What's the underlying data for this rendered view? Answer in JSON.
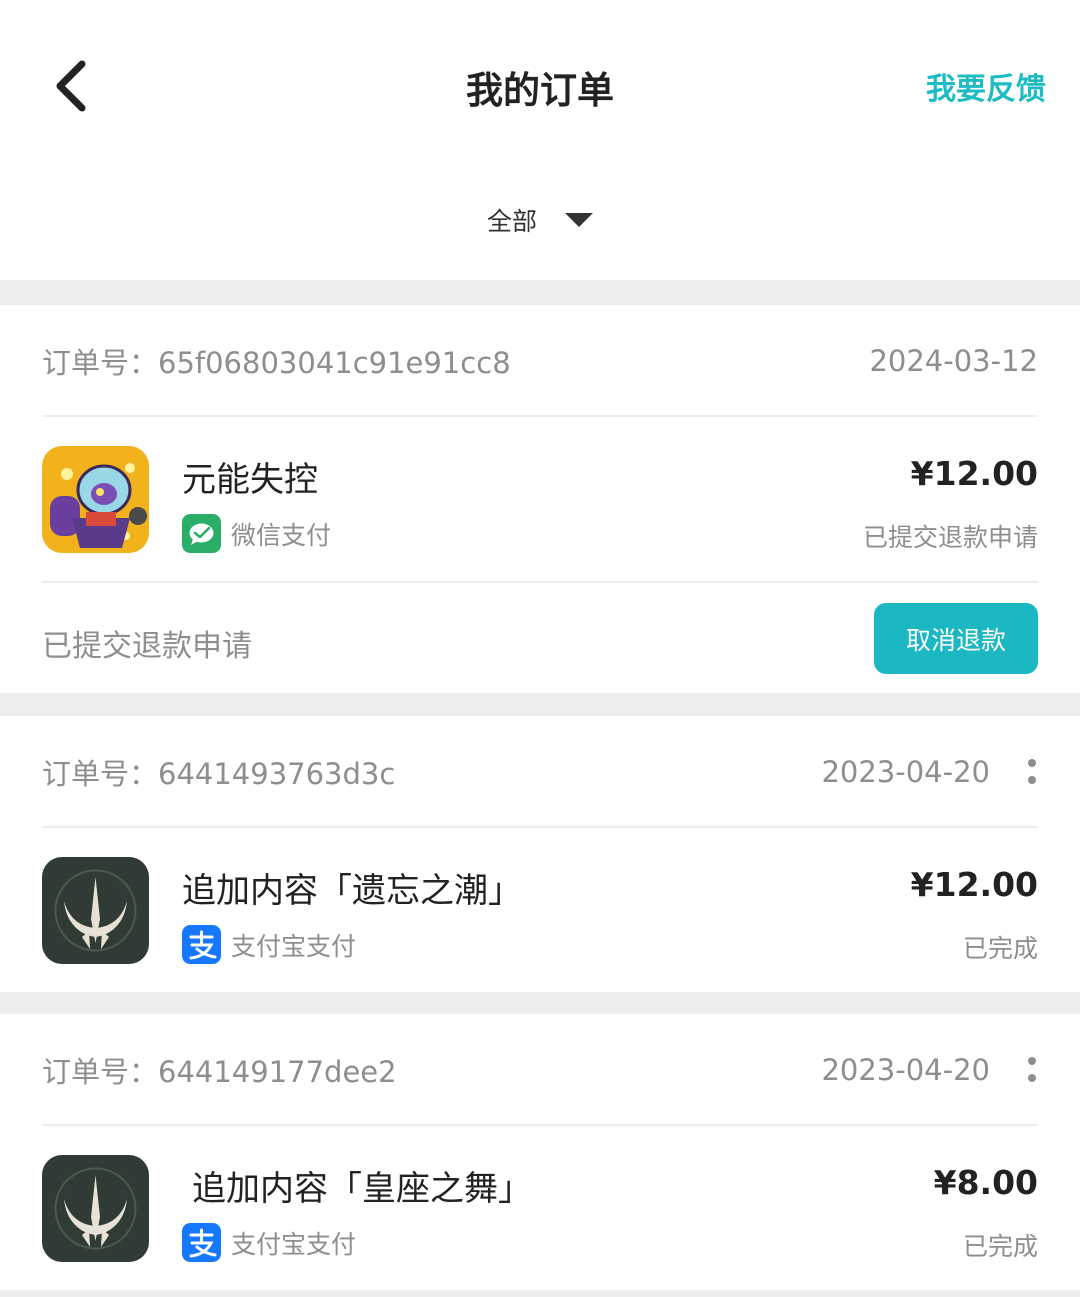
{
  "header": {
    "title": "我的订单",
    "feedback": "我要反馈",
    "back_icon": "chevron-left-icon"
  },
  "filter": {
    "label": "全部",
    "icon": "caret-down-icon"
  },
  "orders": [
    {
      "order_label": "订单号：65f06803041c91e91cc8",
      "date": "2024-03-12",
      "title": "元能失控",
      "payment": "微信支付",
      "payment_icon": "wechat-pay-icon",
      "price": "¥12.00",
      "status": "已提交退款申请",
      "footer_status": "已提交退款申请",
      "action": "取消退款"
    },
    {
      "order_label": "订单号：6441493763d3c",
      "date": "2023-04-20",
      "title": "追加内容「遗忘之潮」",
      "payment": "支付宝支付",
      "payment_icon": "alipay-icon",
      "price": "¥12.00",
      "status": "已完成"
    },
    {
      "order_label": "订单号：644149177dee2",
      "date": "2023-04-20",
      "title": "追加内容「皇座之舞」",
      "payment": "支付宝支付",
      "payment_icon": "alipay-icon",
      "price": "¥8.00",
      "status": "已完成"
    }
  ],
  "colors": {
    "accent": "#1bb7c2",
    "wechat": "#2aae67",
    "alipay": "#1678ff"
  }
}
